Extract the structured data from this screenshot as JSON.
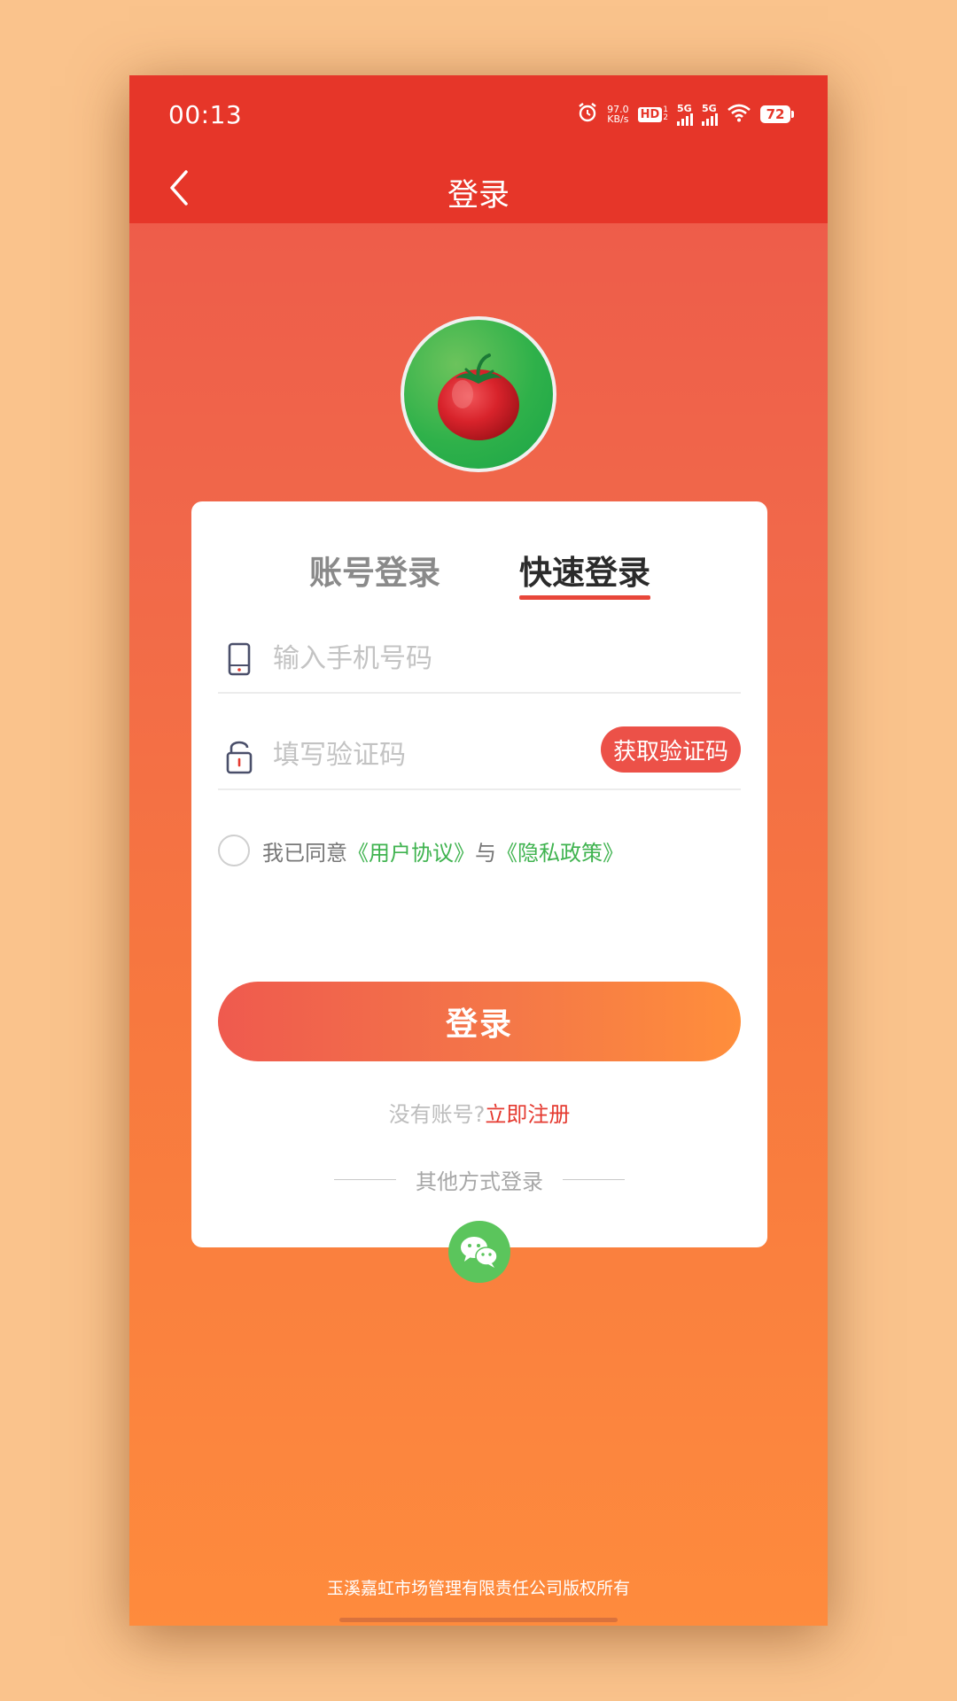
{
  "status_bar": {
    "time": "00:13",
    "net_speed_value": "97.0",
    "net_speed_unit": "KB/s",
    "hd_label": "HD",
    "hd_sub_top": "1",
    "hd_sub_bottom": "2",
    "signal1_label": "5G",
    "signal2_label": "5G",
    "battery": "72"
  },
  "header": {
    "title": "登录"
  },
  "tabs": [
    {
      "label": "账号登录",
      "active": false
    },
    {
      "label": "快速登录",
      "active": true
    }
  ],
  "form": {
    "phone_placeholder": "输入手机号码",
    "code_placeholder": "填写验证码",
    "get_code_label": "获取验证码"
  },
  "agreement": {
    "prefix": "我已同意",
    "user_agreement": "《用户协议》",
    "conjunction": "与",
    "privacy_policy": "《隐私政策》"
  },
  "login_button": "登录",
  "register": {
    "hint": "没有账号?",
    "link": "立即注册"
  },
  "other_login": {
    "label": "其他方式登录",
    "wechat_icon": "wechat-icon"
  },
  "footer": {
    "copyright": "玉溪嘉虹市场管理有限责任公司版权所有"
  },
  "colors": {
    "primary_red": "#e63629",
    "accent_orange": "#fe8b3d",
    "link_green": "#3fb34f",
    "wechat_green": "#5bc55c"
  }
}
